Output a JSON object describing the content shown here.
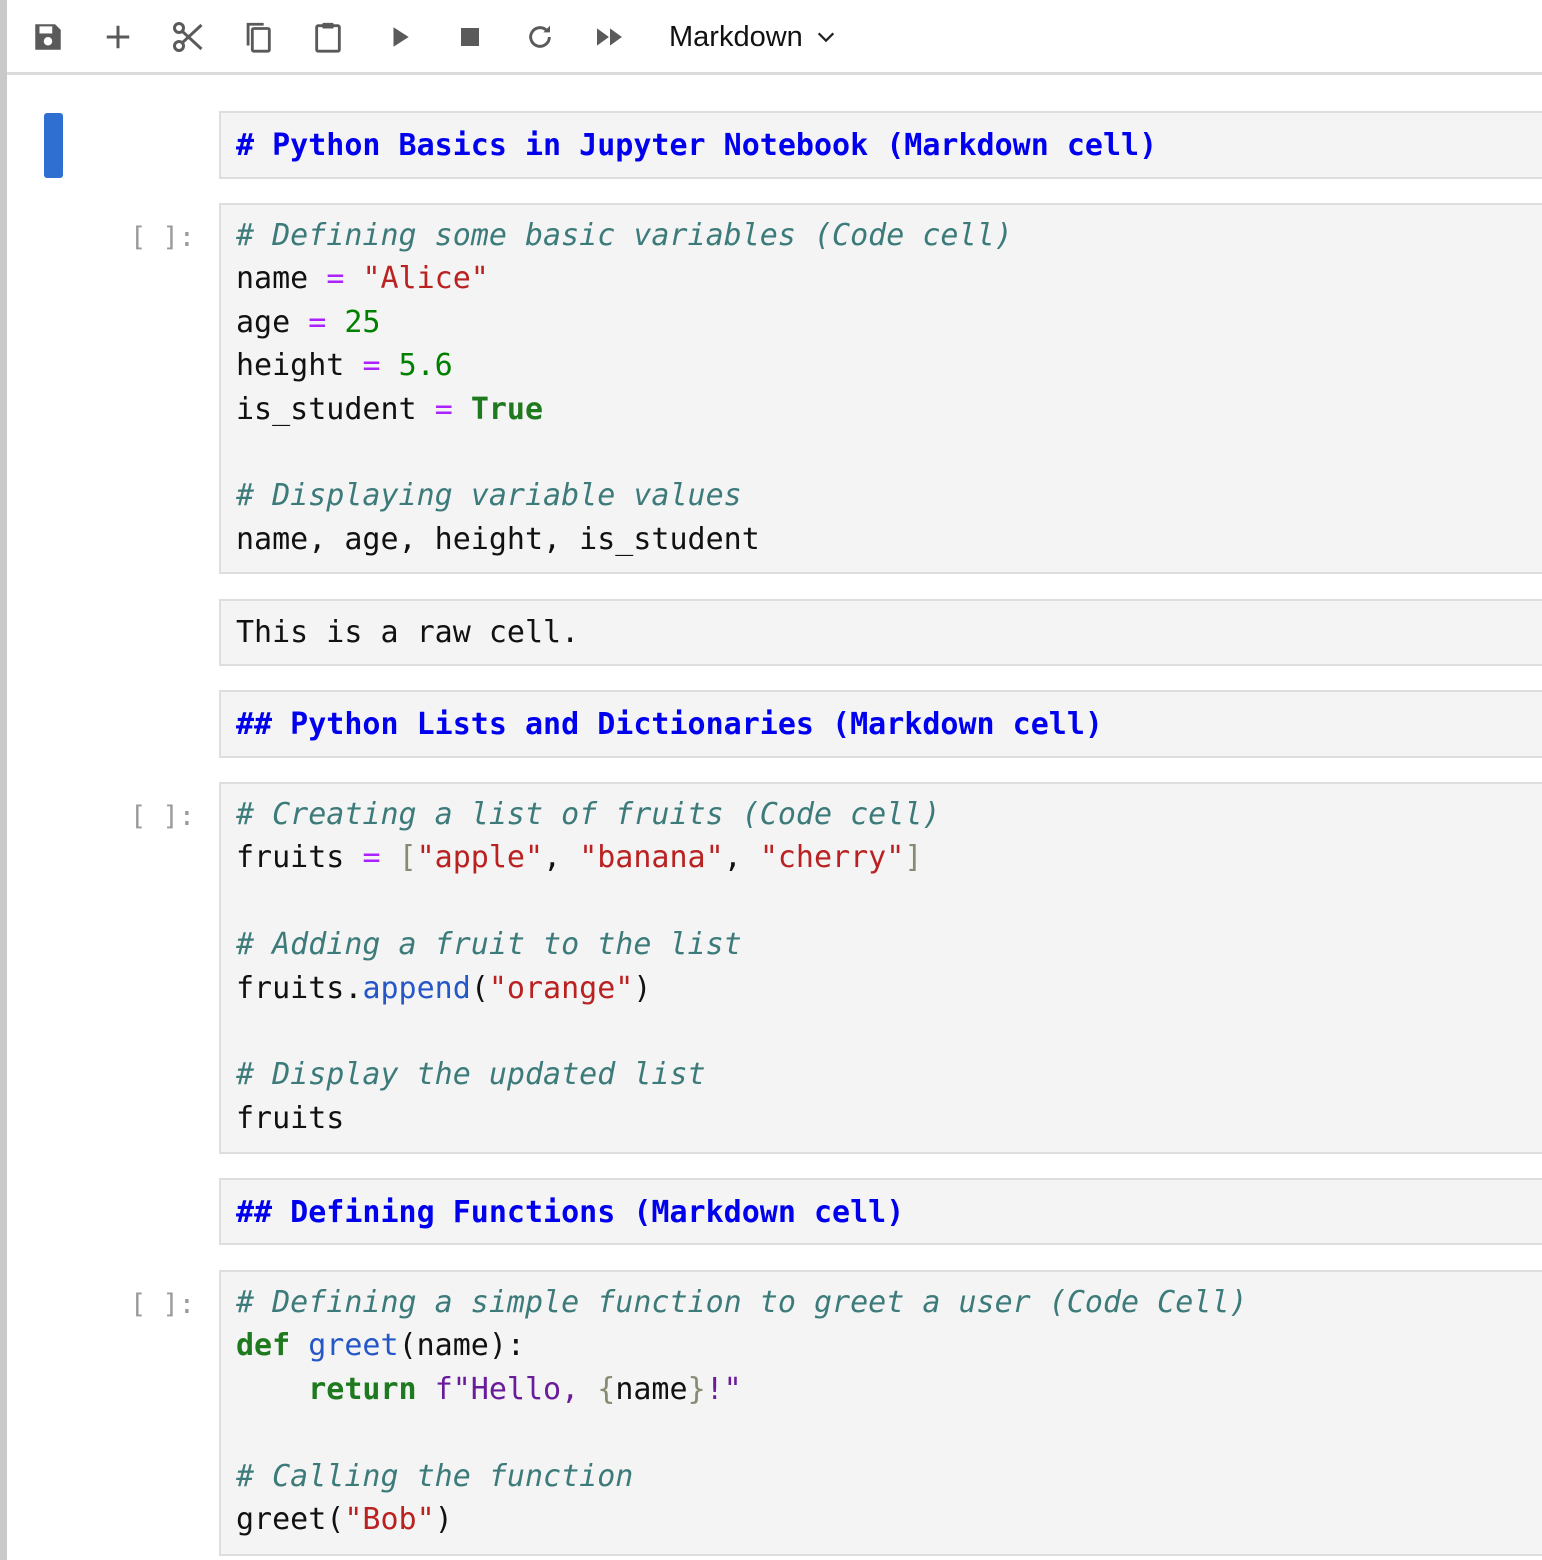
{
  "toolbar": {
    "buttons": [
      {
        "name": "save-icon"
      },
      {
        "name": "plus-icon"
      },
      {
        "name": "scissors-icon"
      },
      {
        "name": "copy-icon"
      },
      {
        "name": "clipboard-icon"
      },
      {
        "name": "play-icon"
      },
      {
        "name": "stop-icon"
      },
      {
        "name": "restart-icon"
      },
      {
        "name": "fast-forward-icon"
      }
    ],
    "cell_type": "Markdown",
    "dropdown_icon": "chevron-down-icon"
  },
  "colors": {
    "accent": "#2f6fd1",
    "markdown_heading": "#0000ee",
    "comment": "#3d7b7b",
    "operator": "#aa22ff",
    "string": "#ba2121",
    "number": "#008000",
    "keyword": "#1f7a1f",
    "function": "#2557c7"
  },
  "cells": {
    "c1": {
      "type": "markdown",
      "text": "# Python Basics in Jupyter Notebook (Markdown cell)"
    },
    "c2": {
      "type": "code",
      "prompt": "[ ]:",
      "lines": {
        "l1": {
          "t1": "# Defining some basic variables (Code cell)"
        },
        "l2": {
          "t1": "name ",
          "t2": "=",
          "t3": " ",
          "t4": "\"Alice\""
        },
        "l3": {
          "t1": "age ",
          "t2": "=",
          "t3": " ",
          "t4": "25"
        },
        "l4": {
          "t1": "height ",
          "t2": "=",
          "t3": " ",
          "t4": "5.6"
        },
        "l5": {
          "t1": "is_student ",
          "t2": "=",
          "t3": " ",
          "t4": "True"
        },
        "l7": {
          "t1": "# Displaying variable values"
        },
        "l8": {
          "t1": "name, age, height, is_student"
        }
      }
    },
    "c3": {
      "type": "raw",
      "text": "This is a raw cell."
    },
    "c4": {
      "type": "markdown",
      "text": "## Python Lists and Dictionaries (Markdown cell)"
    },
    "c5": {
      "type": "code",
      "prompt": "[ ]:",
      "lines": {
        "l1": {
          "t1": "# Creating a list of fruits (Code cell)"
        },
        "l2": {
          "t1": "fruits ",
          "t2": "=",
          "t3": " ",
          "t4": "[",
          "t5": "\"apple\"",
          "t6": ", ",
          "t7": "\"banana\"",
          "t8": ", ",
          "t9": "\"cherry\"",
          "t10": "]"
        },
        "l4": {
          "t1": "# Adding a fruit to the list"
        },
        "l5": {
          "t1": "fruits.",
          "t2": "append",
          "t3": "(",
          "t4": "\"orange\"",
          "t5": ")"
        },
        "l7": {
          "t1": "# Display the updated list"
        },
        "l8": {
          "t1": "fruits"
        }
      }
    },
    "c6": {
      "type": "markdown",
      "text": "## Defining Functions (Markdown cell)"
    },
    "c7": {
      "type": "code",
      "prompt": "[ ]:",
      "lines": {
        "l1": {
          "t1": "# Defining a simple function to greet a user (Code Cell)"
        },
        "l2": {
          "t1": "def",
          "t2": " ",
          "t3": "greet",
          "t4": "(name):"
        },
        "l3": {
          "t1": "    ",
          "t2": "return",
          "t3": " ",
          "t4": "f\"Hello, ",
          "t5": "{",
          "t6": "name",
          "t7": "}",
          "t8": "!\""
        },
        "l5": {
          "t1": "# Calling the function"
        },
        "l6": {
          "t1": "greet(",
          "t2": "\"Bob\"",
          "t3": ")"
        }
      }
    }
  }
}
